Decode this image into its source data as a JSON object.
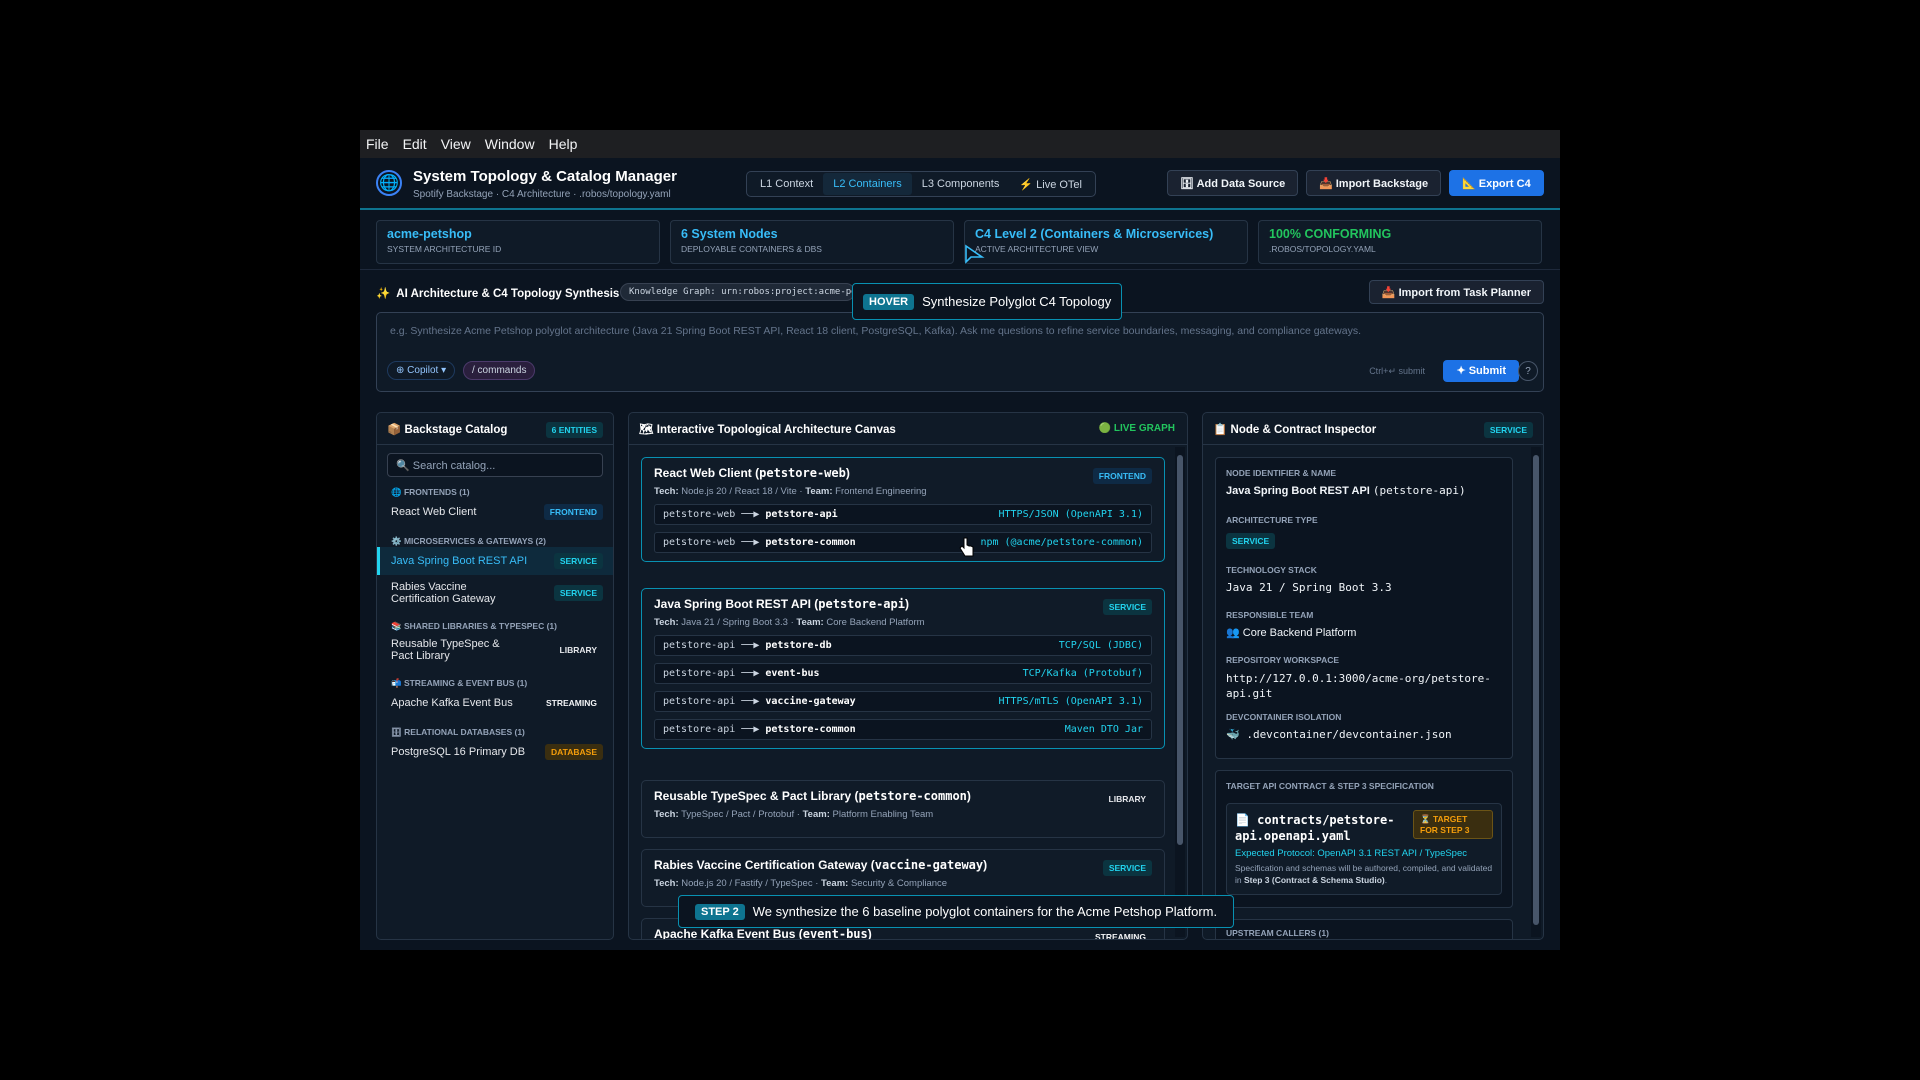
{
  "menu": [
    "File",
    "Edit",
    "View",
    "Window",
    "Help"
  ],
  "header": {
    "title": "System Topology & Catalog Manager",
    "subtitle": "Spotify Backstage · C4 Architecture · .robos/topology.yaml",
    "tabs": [
      "L1 Context",
      "L2 Containers",
      "L3 Components",
      "⚡ Live OTel"
    ],
    "add_source": "🗄 Add Data Source",
    "import_backstage": "📥 Import Backstage",
    "export": "📐 Export C4"
  },
  "stats": [
    {
      "value": "acme-petshop",
      "label": "SYSTEM ARCHITECTURE ID"
    },
    {
      "value": "6 System Nodes",
      "label": "DEPLOYABLE CONTAINERS & DBS"
    },
    {
      "value": "C4 Level 2 (Containers & Microservices)",
      "label": "ACTIVE ARCHITECTURE VIEW"
    },
    {
      "value": "100% CONFORMING",
      "label": ".ROBOS/TOPOLOGY.YAML"
    }
  ],
  "ai": {
    "title": "AI Architecture & C4 Topology Synthesis",
    "kg": "Knowledge Graph: urn:robos:project:acme-pe",
    "import": "📥 Import from Task Planner",
    "placeholder": "e.g. Synthesize Acme Petshop polyglot architecture (Java 21 Spring Boot REST API, React 18 client, PostgreSQL, Kafka). Ask me questions to refine service boundaries, messaging, and compliance gateways.",
    "copilot": "⊕ Copilot ▾",
    "commands": "/ commands",
    "hint": "Ctrl+↵ submit",
    "submit": "✦ Submit",
    "help": "?"
  },
  "catalog": {
    "title": "📦 Backstage Catalog",
    "count": "6 Entities",
    "search": "🔍 Search catalog...",
    "groups": [
      {
        "name": "🌐 FRONTENDS (1)",
        "items": [
          {
            "label": "React Web Client",
            "badge": "FRONTEND"
          }
        ]
      },
      {
        "name": "⚙️ MICROSERVICES & GATEWAYS (2)",
        "items": [
          {
            "label": "Java Spring Boot REST API",
            "badge": "SERVICE"
          },
          {
            "label": "Rabies Vaccine Certification Gateway",
            "badge": "SERVICE"
          }
        ]
      },
      {
        "name": "📚 SHARED LIBRARIES & TYPESPEC (1)",
        "items": [
          {
            "label": "Reusable TypeSpec & Pact Library",
            "badge": "LIBRARY"
          }
        ]
      },
      {
        "name": "📬 STREAMING & EVENT BUS (1)",
        "items": [
          {
            "label": "Apache Kafka Event Bus",
            "badge": "STREAMING"
          }
        ]
      },
      {
        "name": "🗄 RELATIONAL DATABASES (1)",
        "items": [
          {
            "label": "PostgreSQL 16 Primary DB",
            "badge": "DATABASE"
          }
        ]
      }
    ]
  },
  "canvas": {
    "title": "🗺 Interactive Topological Architecture Canvas",
    "live": "🟢 LIVE GRAPH",
    "cards": [
      {
        "name": "React Web Client",
        "id": "petstore-web",
        "badge": "FRONTEND",
        "tech": "Node.js 20 / React 18 / Vite",
        "team": "Frontend Engineering",
        "edges": [
          {
            "from": "petstore-web",
            "to": "petstore-api",
            "proto": "HTTPS/JSON (OpenAPI 3.1)"
          },
          {
            "from": "petstore-web",
            "to": "petstore-common",
            "proto": "npm (@acme/petstore-common)"
          }
        ]
      },
      {
        "name": "Java Spring Boot REST API",
        "id": "petstore-api",
        "badge": "SERVICE",
        "tech": "Java 21 / Spring Boot 3.3",
        "team": "Core Backend Platform",
        "edges": [
          {
            "from": "petstore-api",
            "to": "petstore-db",
            "proto": "TCP/SQL (JDBC)"
          },
          {
            "from": "petstore-api",
            "to": "event-bus",
            "proto": "TCP/Kafka (Protobuf)"
          },
          {
            "from": "petstore-api",
            "to": "vaccine-gateway",
            "proto": "HTTPS/mTLS (OpenAPI 3.1)"
          },
          {
            "from": "petstore-api",
            "to": "petstore-common",
            "proto": "Maven DTO Jar"
          }
        ]
      },
      {
        "name": "Reusable TypeSpec & Pact Library",
        "id": "petstore-common",
        "badge": "LIBRARY",
        "tech": "TypeSpec / Pact / Protobuf",
        "team": "Platform Enabling Team",
        "edges": []
      },
      {
        "name": "Rabies Vaccine Certification Gateway",
        "id": "vaccine-gateway",
        "badge": "SERVICE",
        "tech": "Node.js 20 / Fastify / TypeSpec",
        "team": "Security & Compliance",
        "edges": []
      },
      {
        "name": "Apache Kafka Event Bus",
        "id": "event-bus",
        "badge": "STREAMING",
        "tech": "",
        "team": "",
        "edges": []
      }
    ],
    "arrow": "──▶",
    "tech_label": "Tech:",
    "team_label": "Team:"
  },
  "inspector": {
    "title": "📋 Node & Contract Inspector",
    "badge": "SERVICE",
    "id_label": "NODE IDENTIFIER & NAME",
    "name": "Java Spring Boot REST API",
    "name_id": "(petstore-api)",
    "type_label": "ARCHITECTURE TYPE",
    "type": "SERVICE",
    "stack_label": "TECHNOLOGY STACK",
    "stack": "Java 21 / Spring Boot 3.3",
    "team_label": "RESPONSIBLE TEAM",
    "team": "👥 Core Backend Platform",
    "repo_label": "REPOSITORY WORKSPACE",
    "repo": "http://127.0.0.1:3000/acme-org/petstore-api.git",
    "dev_label": "DEVCONTAINER ISOLATION",
    "dev": "🐳 .devcontainer/devcontainer.json",
    "contract_label": "TARGET API CONTRACT & STEP 3 SPECIFICATION",
    "contract_file": "📄 contracts/petstore-api.openapi.yaml",
    "target": "⏳ TARGET FOR STEP 3",
    "protocol": "Expected Protocol: OpenAPI 3.1 REST API / TypeSpec",
    "spec_note": "Specification and schemas will be authored, compiled, and validated in",
    "spec_step": "Step 3 (Contract & Schema Studio)",
    "upstream": "UPSTREAM CALLERS (1)"
  },
  "hover": {
    "tag": "HOVER",
    "text": "Synthesize Polyglot C4 Topology"
  },
  "step": {
    "tag": "STEP 2",
    "text": "We synthesize the 6 baseline polyglot containers for the Acme Petshop Platform."
  },
  "colors": {
    "accent": "#22d3ee",
    "primary": "#1d72e6",
    "bg": "#0b1420"
  }
}
